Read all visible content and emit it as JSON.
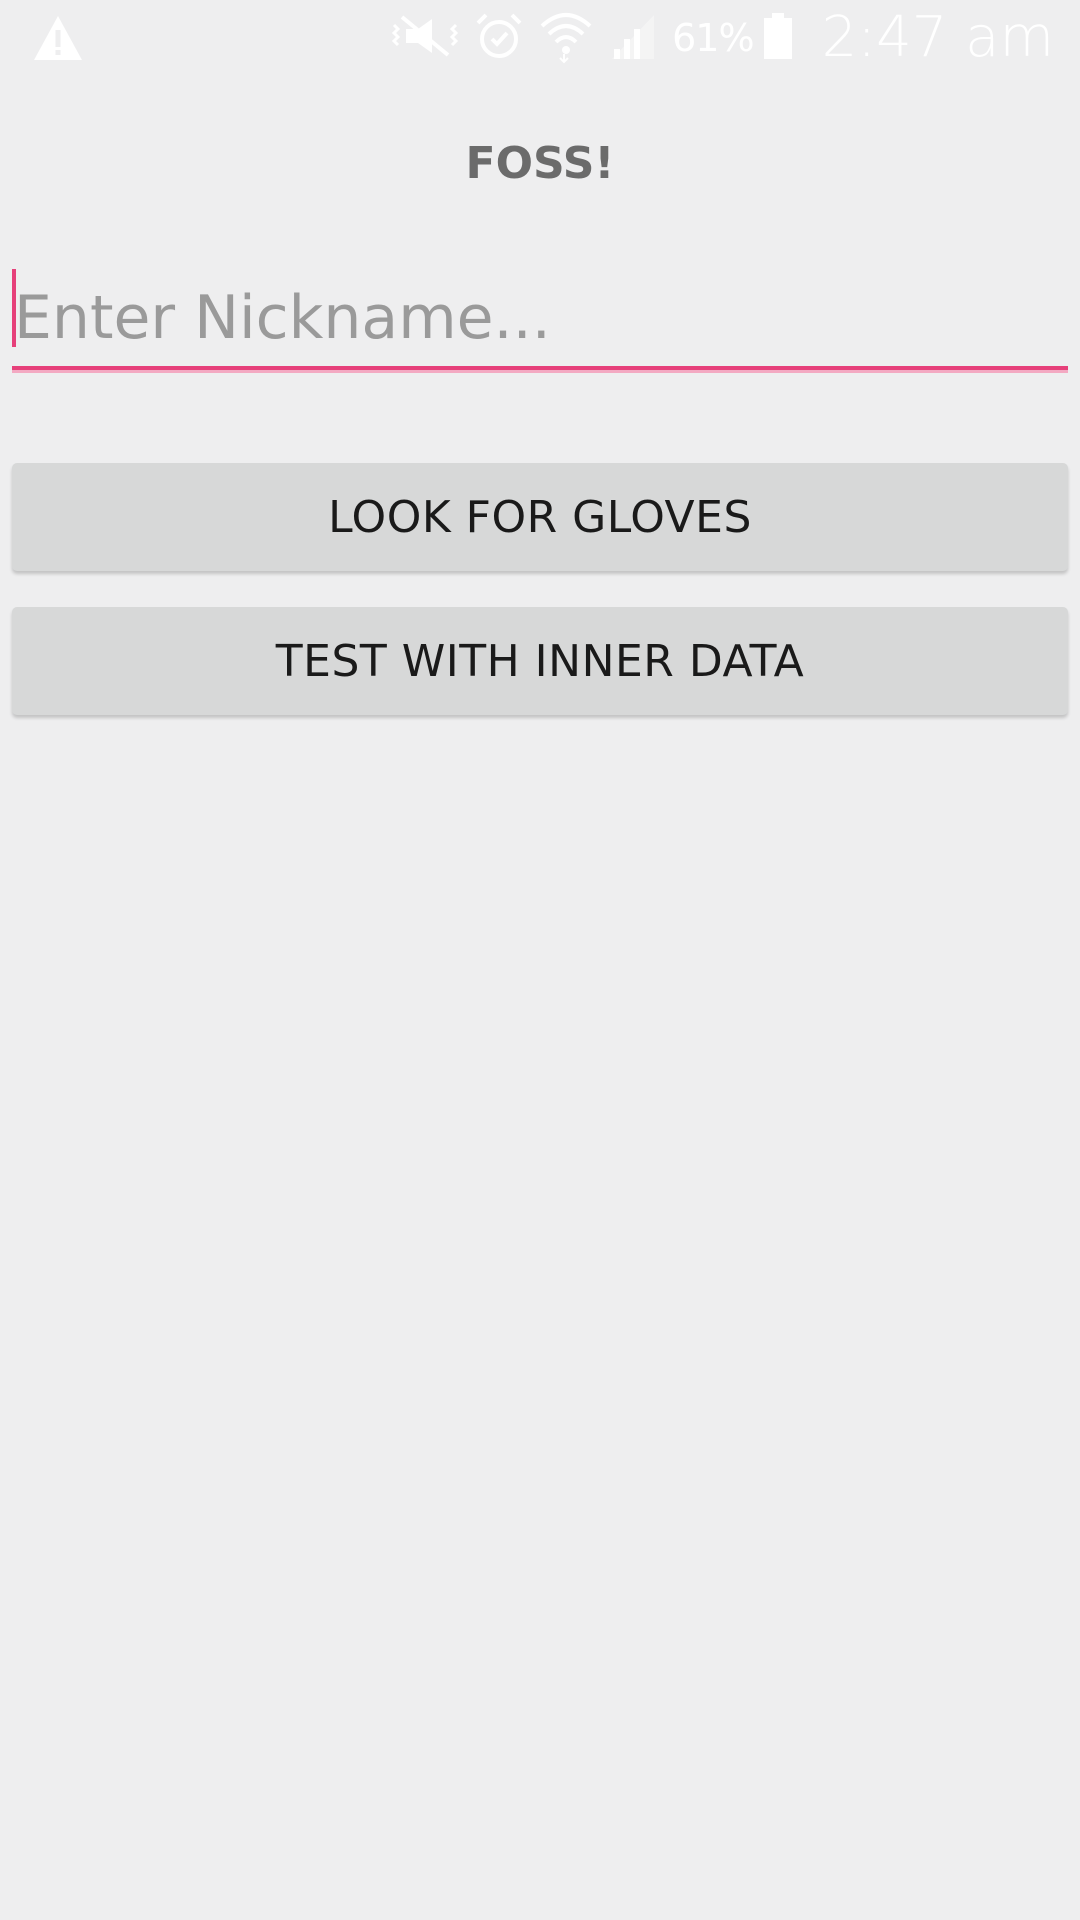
{
  "status_bar": {
    "icons": [
      "warning-icon",
      "vibrate-mute-icon",
      "alarm-icon",
      "wifi-icon",
      "signal-icon",
      "battery-icon"
    ],
    "battery": "61%",
    "time": "2:47 am"
  },
  "app": {
    "title": "FOSS!"
  },
  "nickname": {
    "placeholder": "Enter Nickname...",
    "value": ""
  },
  "buttons": {
    "look_for_gloves": "LOOK FOR GLOVES",
    "test_with_inner_data": "TEST WITH INNER DATA"
  },
  "colors": {
    "accent": "#e6407a",
    "background": "#eeeeef",
    "button": "#d7d8d8"
  }
}
